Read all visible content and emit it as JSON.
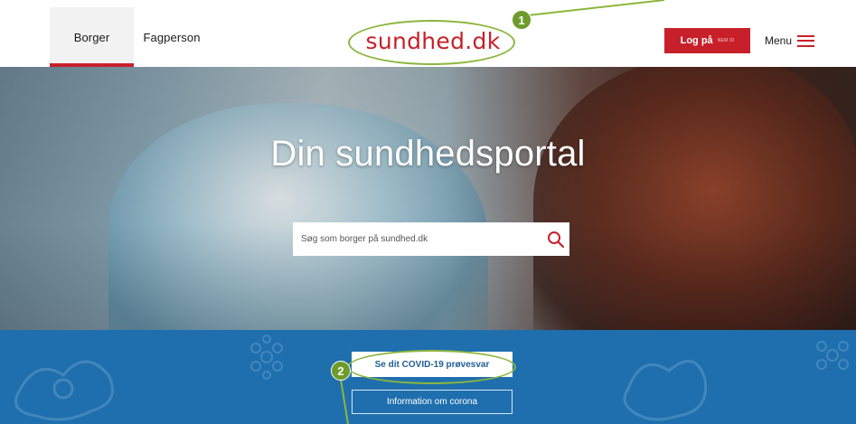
{
  "header": {
    "tabs": [
      {
        "label": "Borger",
        "active": true
      },
      {
        "label": "Fagperson",
        "active": false
      }
    ],
    "logo_text": "sundhed.dk",
    "login": {
      "label": "Log på",
      "sub_label": "NEM ID"
    },
    "menu_label": "Menu",
    "icons": {
      "menu": "hamburger-icon"
    }
  },
  "hero": {
    "title": "Din sundhedsportal",
    "search": {
      "placeholder": "Søg som borger på sundhed.dk",
      "icon": "search-icon"
    }
  },
  "banner": {
    "primary_button": "Se dit COVID-19 prøvesvar",
    "secondary_button": "Information om corona"
  },
  "annotations": {
    "markers": [
      "1",
      "2"
    ]
  },
  "colors": {
    "brand_red": "#c8202a",
    "banner_blue": "#1f6fae",
    "annotation_green": "#8cb63c"
  }
}
